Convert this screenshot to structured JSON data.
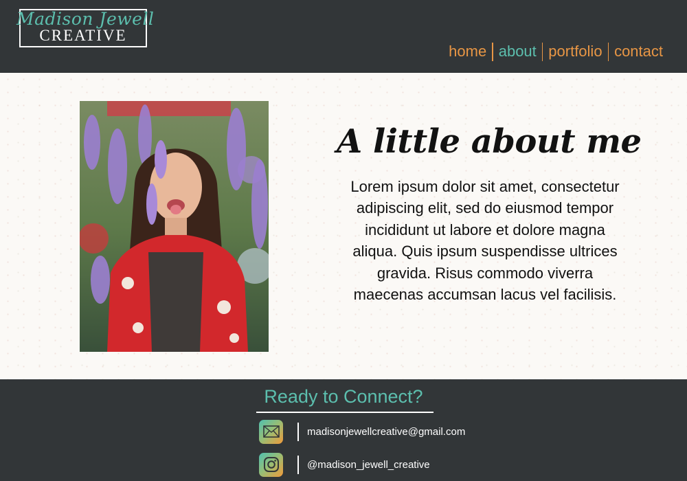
{
  "brand": {
    "script": "Madison Jewell",
    "word": "CREATIVE"
  },
  "nav": {
    "items": [
      {
        "label": "home"
      },
      {
        "label": "about",
        "active": true
      },
      {
        "label": "portfolio"
      },
      {
        "label": "contact"
      }
    ]
  },
  "about": {
    "title": "A little about me",
    "body": "Lorem ipsum dolor sit amet, consectetur adipiscing elit, sed do eiusmod tempor incididunt ut labore et dolore magna aliqua. Quis ipsum suspendisse ultrices gravida. Risus commodo viverra maecenas accumsan lacus vel facilisis."
  },
  "footer": {
    "title": "Ready to Connect?",
    "email": "madisonjewellcreative@gmail.com",
    "instagram": "@madison_jewell_creative"
  },
  "icons": {
    "email": "envelope-icon",
    "instagram": "instagram-icon"
  },
  "colors": {
    "header_bg": "#323638",
    "accent_teal": "#5cbfae",
    "accent_orange": "#e89645",
    "page_bg": "#fbf9f6"
  }
}
